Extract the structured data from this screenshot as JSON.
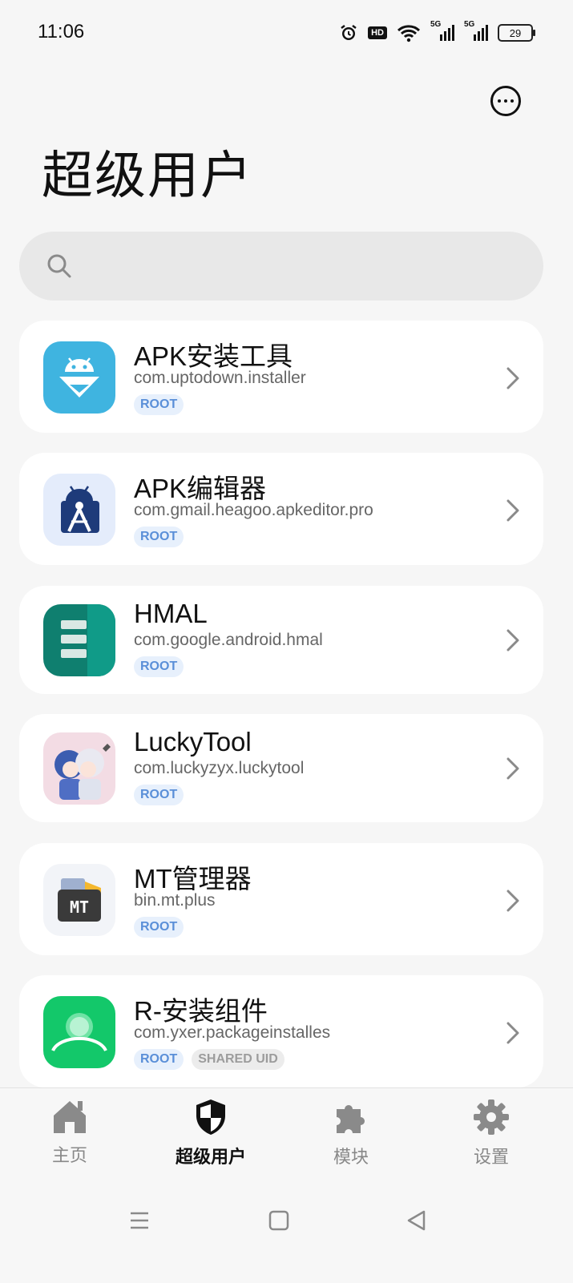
{
  "status_bar": {
    "time": "11:06",
    "icons": [
      "alarm-icon",
      "hd-icon",
      "wifi-icon",
      "signal-5g-icon",
      "signal-5g-icon",
      "battery-icon"
    ],
    "hd_label": "HD",
    "network_label": "5G",
    "battery_level": "29"
  },
  "header": {
    "title": "超级用户",
    "more_icon": "more-icon"
  },
  "search": {
    "placeholder": "",
    "value": ""
  },
  "apps": [
    {
      "name": "APK安装工具",
      "package": "com.uptodown.installer",
      "badges": [
        "ROOT"
      ]
    },
    {
      "name": "APK编辑器",
      "package": "com.gmail.heagoo.apkeditor.pro",
      "badges": [
        "ROOT"
      ]
    },
    {
      "name": "HMAL",
      "package": "com.google.android.hmal",
      "badges": [
        "ROOT"
      ]
    },
    {
      "name": "LuckyTool",
      "package": "com.luckyzyx.luckytool",
      "badges": [
        "ROOT"
      ]
    },
    {
      "name": "MT管理器",
      "package": "bin.mt.plus",
      "badges": [
        "ROOT"
      ],
      "icon_text": "MT"
    },
    {
      "name": "R-安装组件",
      "package": "com.yxer.packageinstalles",
      "badges": [
        "ROOT",
        "SHARED UID"
      ]
    }
  ],
  "bottom_nav": [
    {
      "label": "主页",
      "icon": "home-icon",
      "active": false
    },
    {
      "label": "超级用户",
      "icon": "shield-icon",
      "active": true
    },
    {
      "label": "模块",
      "icon": "puzzle-icon",
      "active": false
    },
    {
      "label": "设置",
      "icon": "gear-icon",
      "active": false
    }
  ],
  "system_nav": [
    "menu-icon",
    "home-square-icon",
    "back-icon"
  ],
  "colors": {
    "background": "#f6f6f6",
    "card": "#ffffff",
    "root_badge_bg": "#e7f0fc",
    "root_badge_text": "#5a8fd8",
    "shared_badge_bg": "#ececec",
    "shared_badge_text": "#9c9c9c"
  }
}
